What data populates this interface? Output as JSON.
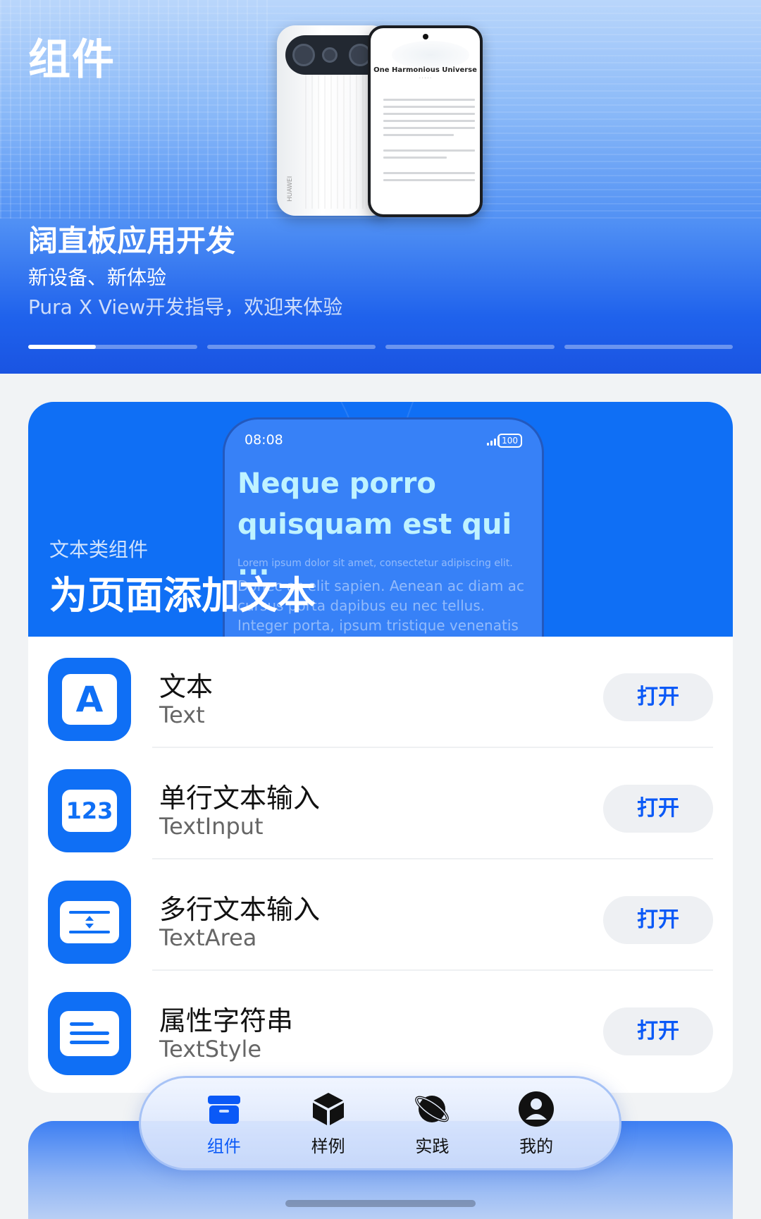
{
  "header": {
    "title": "组件"
  },
  "hero": {
    "device_screen_title": "One Harmonious Universe",
    "device_brand": "HUAWEI",
    "title": "阔直板应用开发",
    "subtitle": "新设备、新体验",
    "description": "Pura X View开发指导，欢迎来体验",
    "carousel_pages": 4,
    "carousel_active_progress": 0.4
  },
  "category": {
    "caption": "文本类组件",
    "heading": "为页面添加文本",
    "mock": {
      "time": "08:08",
      "battery": "100",
      "headline": "Neque porro quisquam est qui ...",
      "small": "Lorem ipsum dolor sit amet, consectetur adipiscing elit.",
      "paragraph": "Donec ac elit sapien. Aenean ac diam ac cursus porta dapibus eu nec tellus. Integer porta, ipsum tristique venenatis fringilla, nisl tellus vulputate justo, at cursus leo libero"
    },
    "items": [
      {
        "name": "文本",
        "sub": "Text",
        "icon": "letter-a-icon",
        "action": "打开"
      },
      {
        "name": "单行文本输入",
        "sub": "TextInput",
        "icon": "number-input-icon",
        "action": "打开",
        "icon_text": "123"
      },
      {
        "name": "多行文本输入",
        "sub": "TextArea",
        "icon": "textarea-icon",
        "action": "打开"
      },
      {
        "name": "属性字符串",
        "sub": "TextStyle",
        "icon": "text-lines-icon",
        "action": "打开"
      }
    ]
  },
  "tabbar": {
    "tabs": [
      {
        "label": "组件",
        "icon": "box-icon",
        "active": true
      },
      {
        "label": "样例",
        "icon": "cube-icon",
        "active": false
      },
      {
        "label": "实践",
        "icon": "planet-icon",
        "active": false
      },
      {
        "label": "我的",
        "icon": "person-icon",
        "active": false
      }
    ]
  },
  "colors": {
    "accent": "#0a59f7",
    "card_blue": "#0f6ff5"
  }
}
